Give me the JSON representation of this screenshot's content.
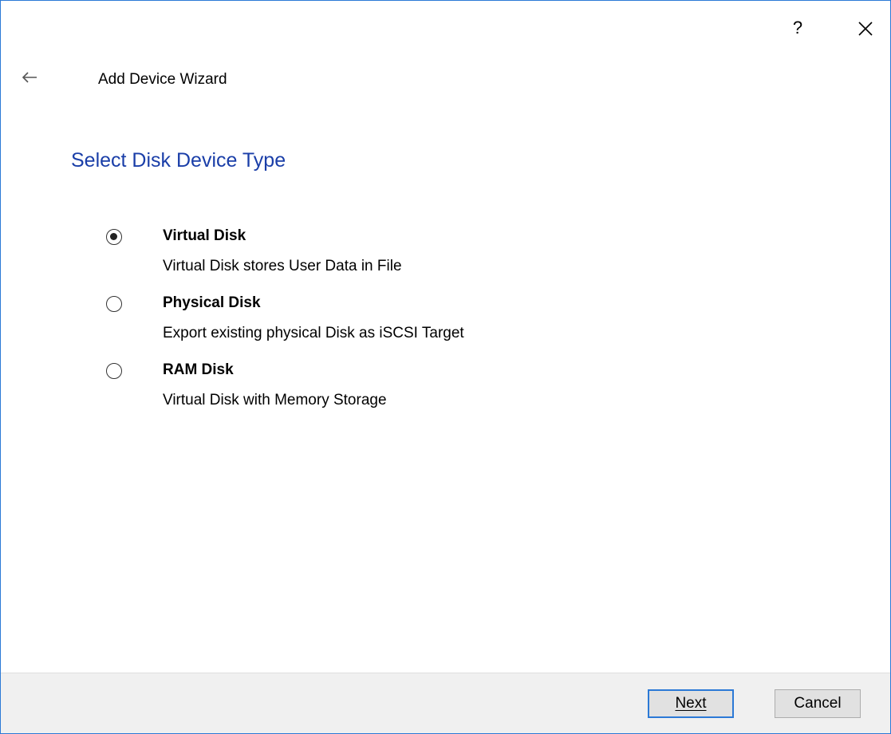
{
  "window": {
    "title": "Add Device Wizard",
    "help_label": "?",
    "border_color": "#2b79d6"
  },
  "icons": {
    "back": "back-arrow-icon",
    "close": "close-icon"
  },
  "page": {
    "heading": "Select Disk Device Type",
    "heading_color": "#1a3ea8"
  },
  "options": [
    {
      "label": "Virtual Disk",
      "description": "Virtual Disk stores User Data in File",
      "selected": true
    },
    {
      "label": "Physical Disk",
      "description": "Export existing physical Disk as iSCSI Target",
      "selected": false
    },
    {
      "label": "RAM Disk",
      "description": "Virtual Disk with Memory Storage",
      "selected": false
    }
  ],
  "footer": {
    "next_label": "Next",
    "cancel_label": "Cancel"
  }
}
